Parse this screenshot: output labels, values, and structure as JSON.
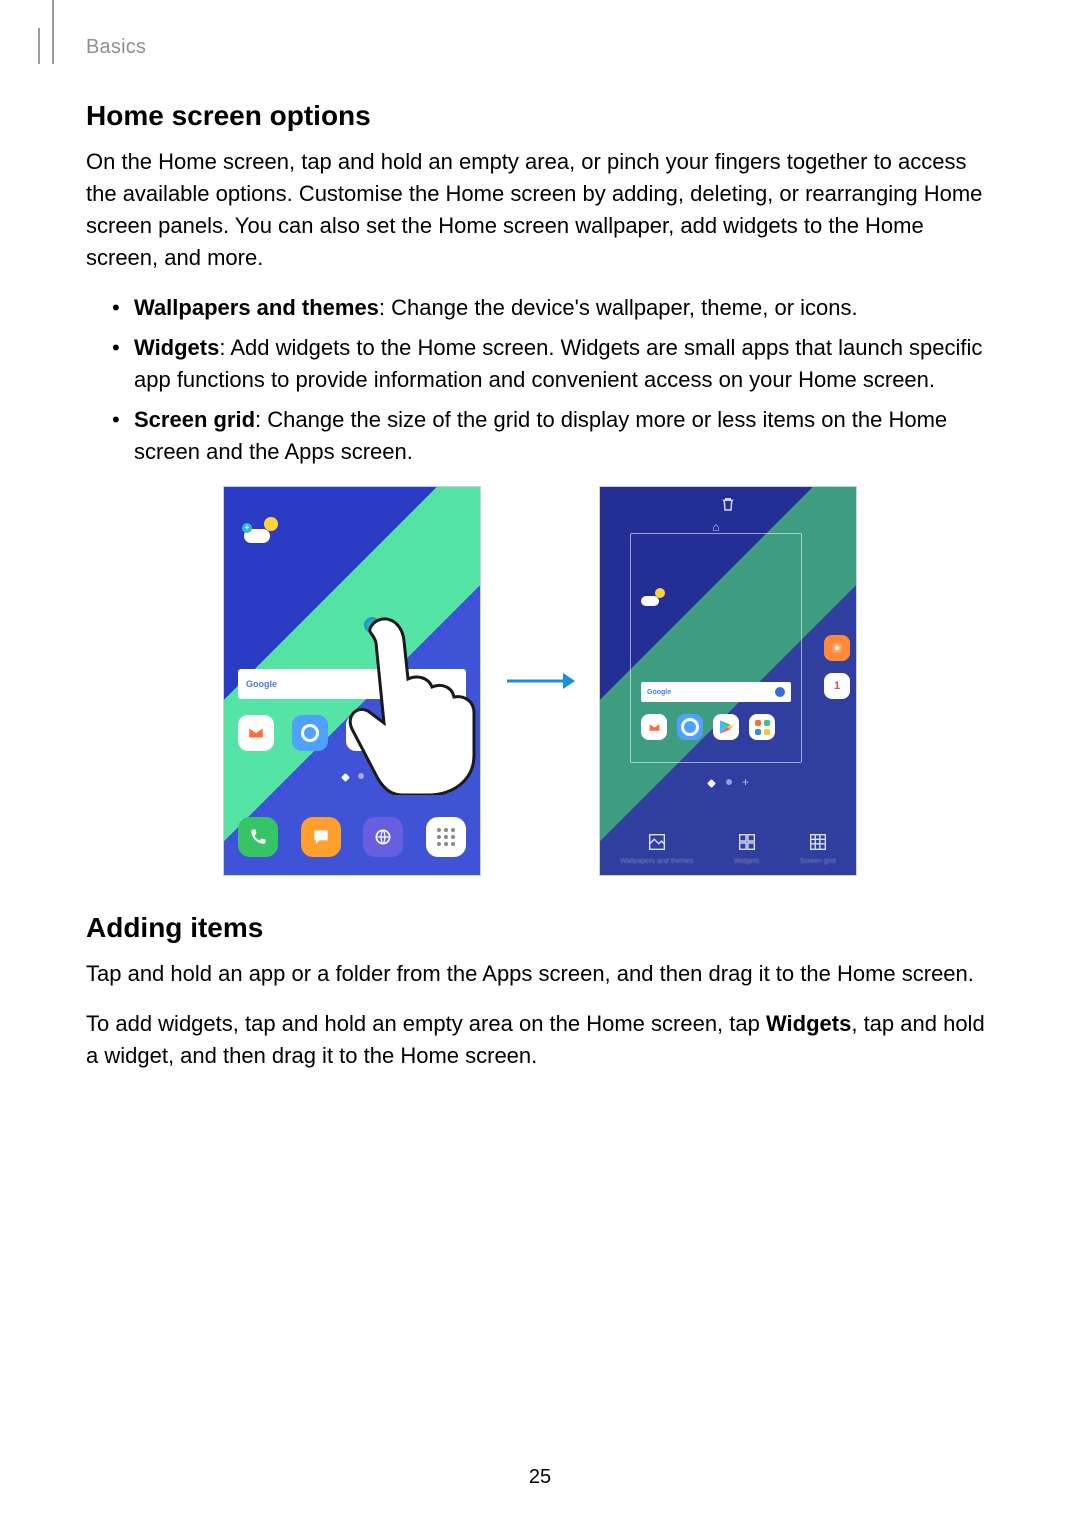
{
  "header": {
    "section": "Basics"
  },
  "section1": {
    "title": "Home screen options",
    "intro": "On the Home screen, tap and hold an empty area, or pinch your fingers together to access the available options. Customise the Home screen by adding, deleting, or rearranging Home screen panels. You can also set the Home screen wallpaper, add widgets to the Home screen, and more.",
    "bullets": [
      {
        "bold": "Wallpapers and themes",
        "rest": ": Change the device's wallpaper, theme, or icons."
      },
      {
        "bold": "Widgets",
        "rest": ": Add widgets to the Home screen. Widgets are small apps that launch specific app functions to provide information and convenient access on your Home screen."
      },
      {
        "bold": "Screen grid",
        "rest": ": Change the size of the grid to display more or less items on the Home screen and the Apps screen."
      }
    ]
  },
  "figure": {
    "left": {
      "search_label": "Google",
      "row_apps": [
        "Email",
        "Internet",
        "Play Store"
      ],
      "dock_apps": [
        "Phone",
        "Messages",
        "Internet",
        "Apps"
      ]
    },
    "right": {
      "mini_search_label": "Google",
      "mini_apps": [
        "Email",
        "Internet",
        "Play Store",
        "Samsung"
      ],
      "side_apps": [
        "Gallery",
        "Calendar"
      ],
      "side_cal_day": "1",
      "options": [
        {
          "name": "wallpapers-themes",
          "label": "Wallpapers and themes"
        },
        {
          "name": "widgets",
          "label": "Widgets"
        },
        {
          "name": "screen-grid",
          "label": "Screen grid"
        }
      ]
    }
  },
  "section2": {
    "title": "Adding items",
    "p1": "Tap and hold an app or a folder from the Apps screen, and then drag it to the Home screen.",
    "p2_a": "To add widgets, tap and hold an empty area on the Home screen, tap ",
    "p2_bold": "Widgets",
    "p2_b": ", tap and hold a widget, and then drag it to the Home screen."
  },
  "page_number": "25"
}
